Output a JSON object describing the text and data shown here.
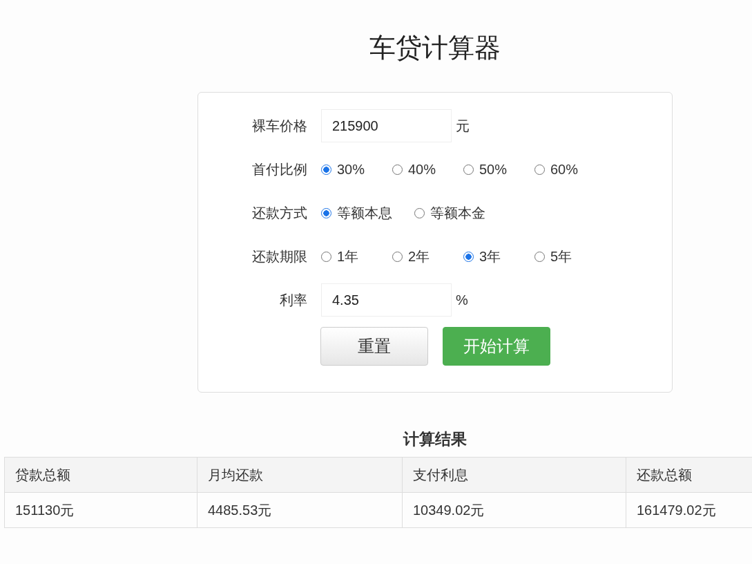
{
  "title": "车贷计算器",
  "form": {
    "rows": [
      {
        "kind": "input",
        "label": "裸车价格",
        "value": "215900",
        "unit": "元"
      },
      {
        "kind": "radio",
        "label": "首付比例",
        "options": [
          {
            "label": "30%",
            "selected": true
          },
          {
            "label": "40%",
            "selected": false
          },
          {
            "label": "50%",
            "selected": false
          },
          {
            "label": "60%",
            "selected": false
          }
        ]
      },
      {
        "kind": "radio",
        "label": "还款方式",
        "options": [
          {
            "label": "等额本息",
            "selected": true
          },
          {
            "label": "等额本金",
            "selected": false
          }
        ]
      },
      {
        "kind": "radio",
        "label": "还款期限",
        "options": [
          {
            "label": "1年",
            "selected": false
          },
          {
            "label": "2年",
            "selected": false
          },
          {
            "label": "3年",
            "selected": true
          },
          {
            "label": "5年",
            "selected": false
          }
        ]
      },
      {
        "kind": "input",
        "label": "利率",
        "value": "4.35",
        "unit": "%"
      }
    ]
  },
  "buttons": [
    {
      "label": "重置",
      "kind": "secondary"
    },
    {
      "label": "开始计算",
      "kind": "primary"
    }
  ],
  "results": {
    "title": "计算结果",
    "columns": [
      "贷款总额",
      "月均还款",
      "支付利息",
      "还款总额"
    ],
    "rows": [
      [
        "151130元",
        "4485.53元",
        "10349.02元",
        "161479.02元"
      ]
    ]
  }
}
